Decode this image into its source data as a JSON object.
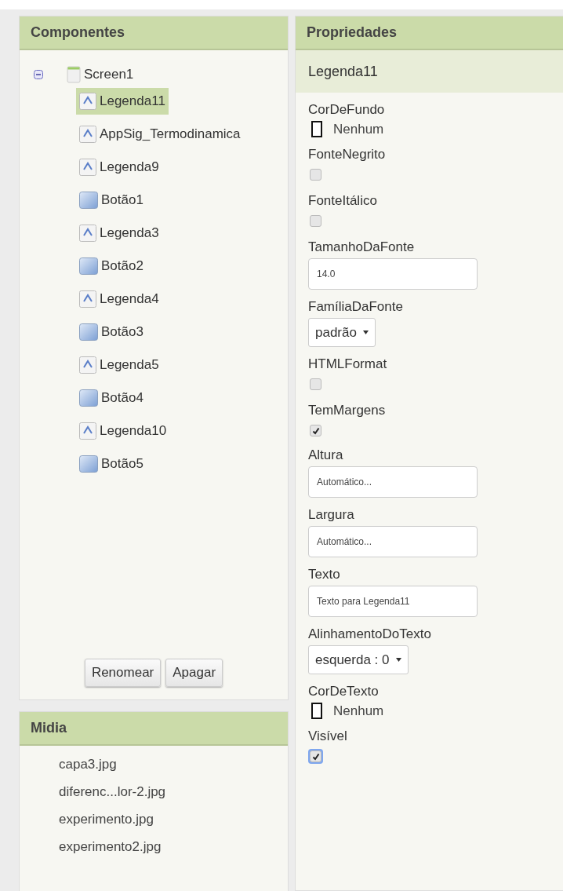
{
  "components": {
    "title": "Componentes",
    "tree": [
      {
        "name": "Screen1",
        "kind": "screen",
        "expanded": true,
        "selected": false,
        "children": [
          {
            "name": "Legenda11",
            "kind": "label",
            "selected": true
          },
          {
            "name": "AppSig_Termodinamica",
            "kind": "label",
            "selected": false
          },
          {
            "name": "Legenda9",
            "kind": "label",
            "selected": false
          },
          {
            "name": "Botão1",
            "kind": "button",
            "selected": false
          },
          {
            "name": "Legenda3",
            "kind": "label",
            "selected": false
          },
          {
            "name": "Botão2",
            "kind": "button",
            "selected": false
          },
          {
            "name": "Legenda4",
            "kind": "label",
            "selected": false
          },
          {
            "name": "Botão3",
            "kind": "button",
            "selected": false
          },
          {
            "name": "Legenda5",
            "kind": "label",
            "selected": false
          },
          {
            "name": "Botão4",
            "kind": "button",
            "selected": false
          },
          {
            "name": "Legenda10",
            "kind": "label",
            "selected": false
          },
          {
            "name": "Botão5",
            "kind": "button",
            "selected": false
          }
        ]
      }
    ],
    "buttons": [
      "Renomear",
      "Apagar"
    ]
  },
  "media": {
    "title": "Midia",
    "items": [
      "capa3.jpg",
      "diferenc...lor-2.jpg",
      "experimento.jpg",
      "experimento2.jpg"
    ]
  },
  "properties": {
    "title": "Propriedades",
    "component": "Legenda11",
    "items": [
      {
        "label": "CorDeFundo",
        "kind": "color",
        "value": "Nenhum"
      },
      {
        "label": "FonteNegrito",
        "kind": "checkbox",
        "checked": false,
        "focused": false
      },
      {
        "label": "FonteItálico",
        "kind": "checkbox",
        "checked": false,
        "focused": false
      },
      {
        "label": "TamanhoDaFonte",
        "kind": "text",
        "value": "14.0"
      },
      {
        "label": "FamíliaDaFonte",
        "kind": "dropdown",
        "value": "padrão"
      },
      {
        "label": "HTMLFormat",
        "kind": "checkbox",
        "checked": false,
        "focused": false
      },
      {
        "label": "TemMargens",
        "kind": "checkbox",
        "checked": true,
        "focused": false
      },
      {
        "label": "Altura",
        "kind": "text",
        "value": "Automático..."
      },
      {
        "label": "Largura",
        "kind": "text",
        "value": "Automático..."
      },
      {
        "label": "Texto",
        "kind": "text",
        "value": "Texto para Legenda11"
      },
      {
        "label": "AlinhamentoDoTexto",
        "kind": "dropdown",
        "value": "esquerda : 0"
      },
      {
        "label": "CorDeTexto",
        "kind": "color",
        "value": "Nenhum"
      },
      {
        "label": "Visível",
        "kind": "checkbox",
        "checked": true,
        "focused": true
      }
    ]
  }
}
